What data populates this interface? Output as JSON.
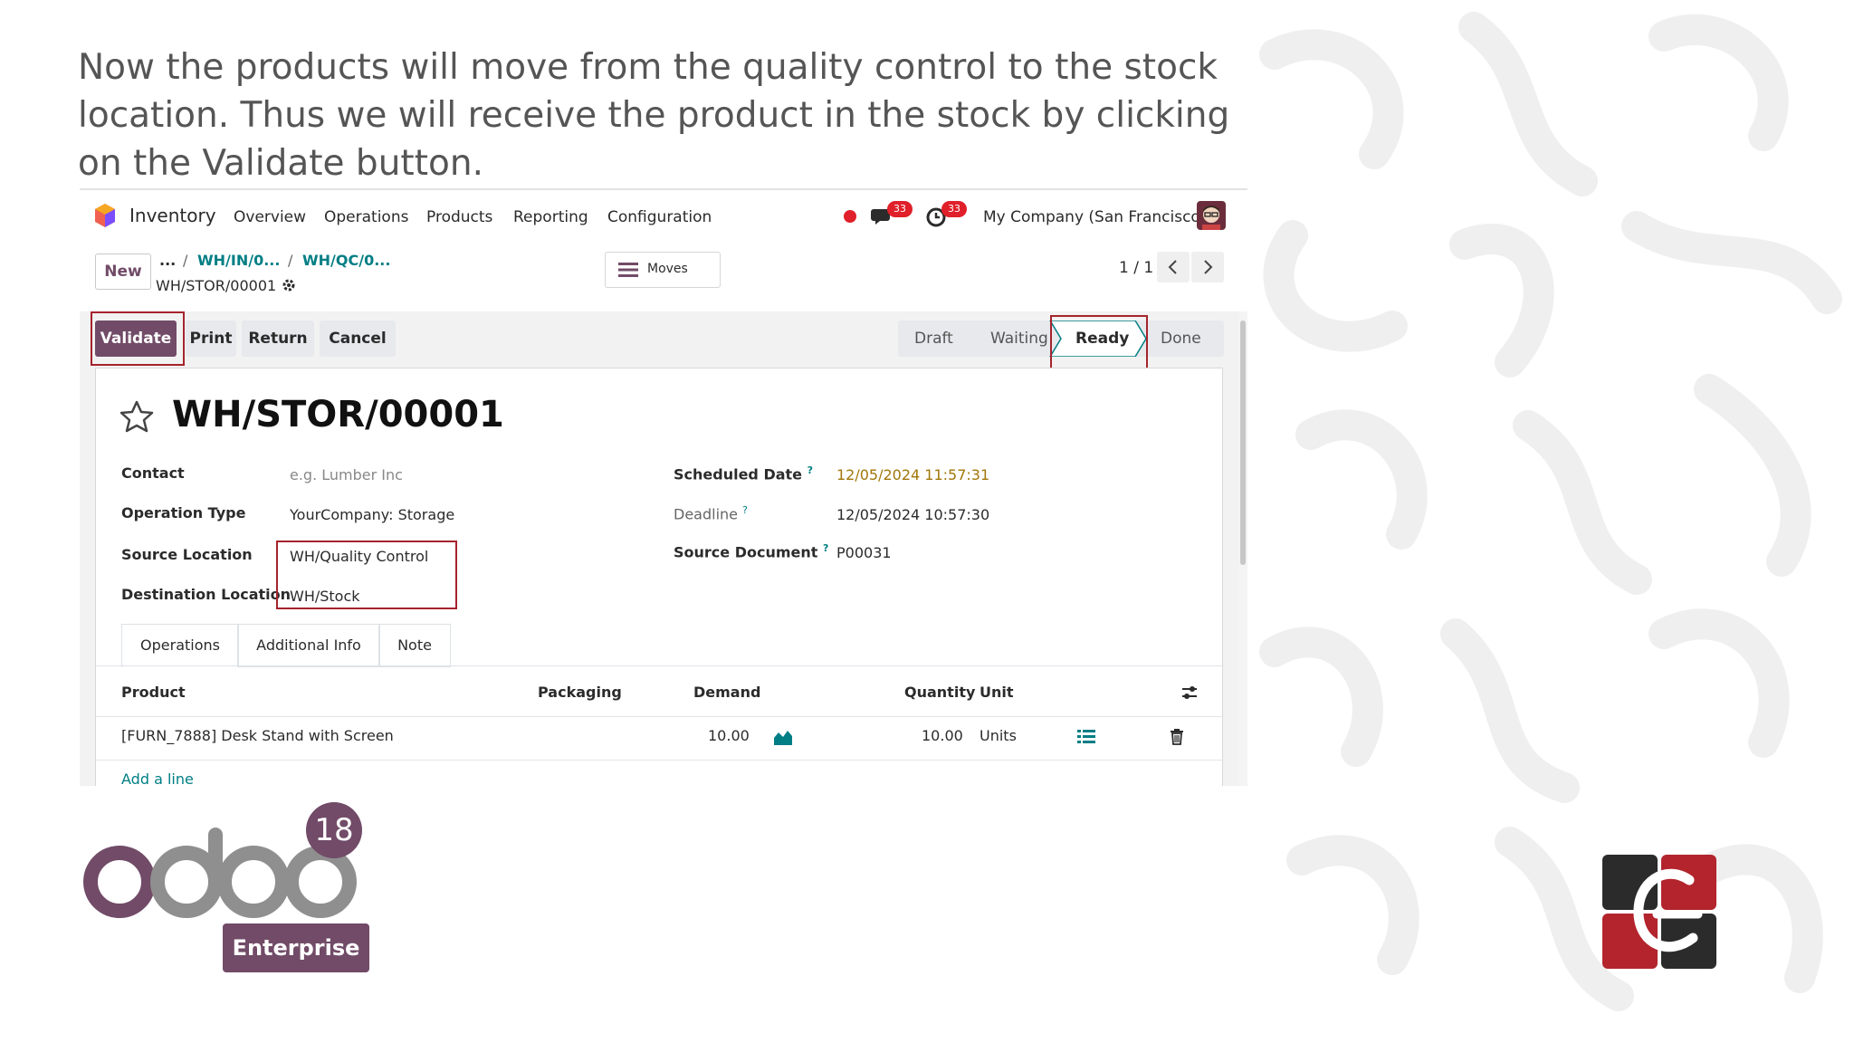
{
  "caption": "Now the products will move from the quality control to the stock location. Thus we will receive the product in the stock by clicking on the Validate button.",
  "navbar": {
    "app_name": "Inventory",
    "menu": [
      "Overview",
      "Operations",
      "Products",
      "Reporting",
      "Configuration"
    ],
    "messages_badge": "33",
    "activities_badge": "33",
    "company": "My Company (San Francisco)"
  },
  "control_panel": {
    "new_label": "New",
    "breadcrumb_ellipsis": "...",
    "breadcrumb_1": "WH/IN/0...",
    "breadcrumb_2": "WH/QC/0...",
    "current_record": "WH/STOR/00001",
    "moves_label": "Moves",
    "pager": "1 / 1"
  },
  "actions": {
    "validate": "Validate",
    "print": "Print",
    "return": "Return",
    "cancel": "Cancel"
  },
  "status": {
    "steps": [
      "Draft",
      "Waiting",
      "Ready",
      "Done"
    ],
    "active": "Ready"
  },
  "record": {
    "title": "WH/STOR/00001",
    "contact_label": "Contact",
    "contact_placeholder": "e.g. Lumber Inc",
    "operation_type_label": "Operation Type",
    "operation_type": "YourCompany: Storage",
    "source_location_label": "Source Location",
    "source_location": "WH/Quality Control",
    "destination_location_label": "Destination Location",
    "destination_location": "WH/Stock",
    "scheduled_date_label": "Scheduled Date",
    "scheduled_date": "12/05/2024 11:57:31",
    "deadline_label": "Deadline",
    "deadline": "12/05/2024 10:57:30",
    "source_document_label": "Source Document",
    "source_document": "P00031",
    "help_mark": "?"
  },
  "tabs": [
    "Operations",
    "Additional Info",
    "Note"
  ],
  "table": {
    "headers": {
      "product": "Product",
      "packaging": "Packaging",
      "demand": "Demand",
      "quantity": "Quantity",
      "unit": "Unit"
    },
    "rows": [
      {
        "product": "[FURN_7888] Desk Stand with Screen",
        "demand": "10.00",
        "quantity": "10.00",
        "unit": "Units"
      }
    ],
    "add_line": "Add a line"
  },
  "branding": {
    "odoo_version": "18",
    "edition": "Enterprise"
  },
  "colors": {
    "primary": "#714b67",
    "link": "#017e84",
    "highlight": "#a5232d",
    "warning_date": "#a1760a"
  }
}
